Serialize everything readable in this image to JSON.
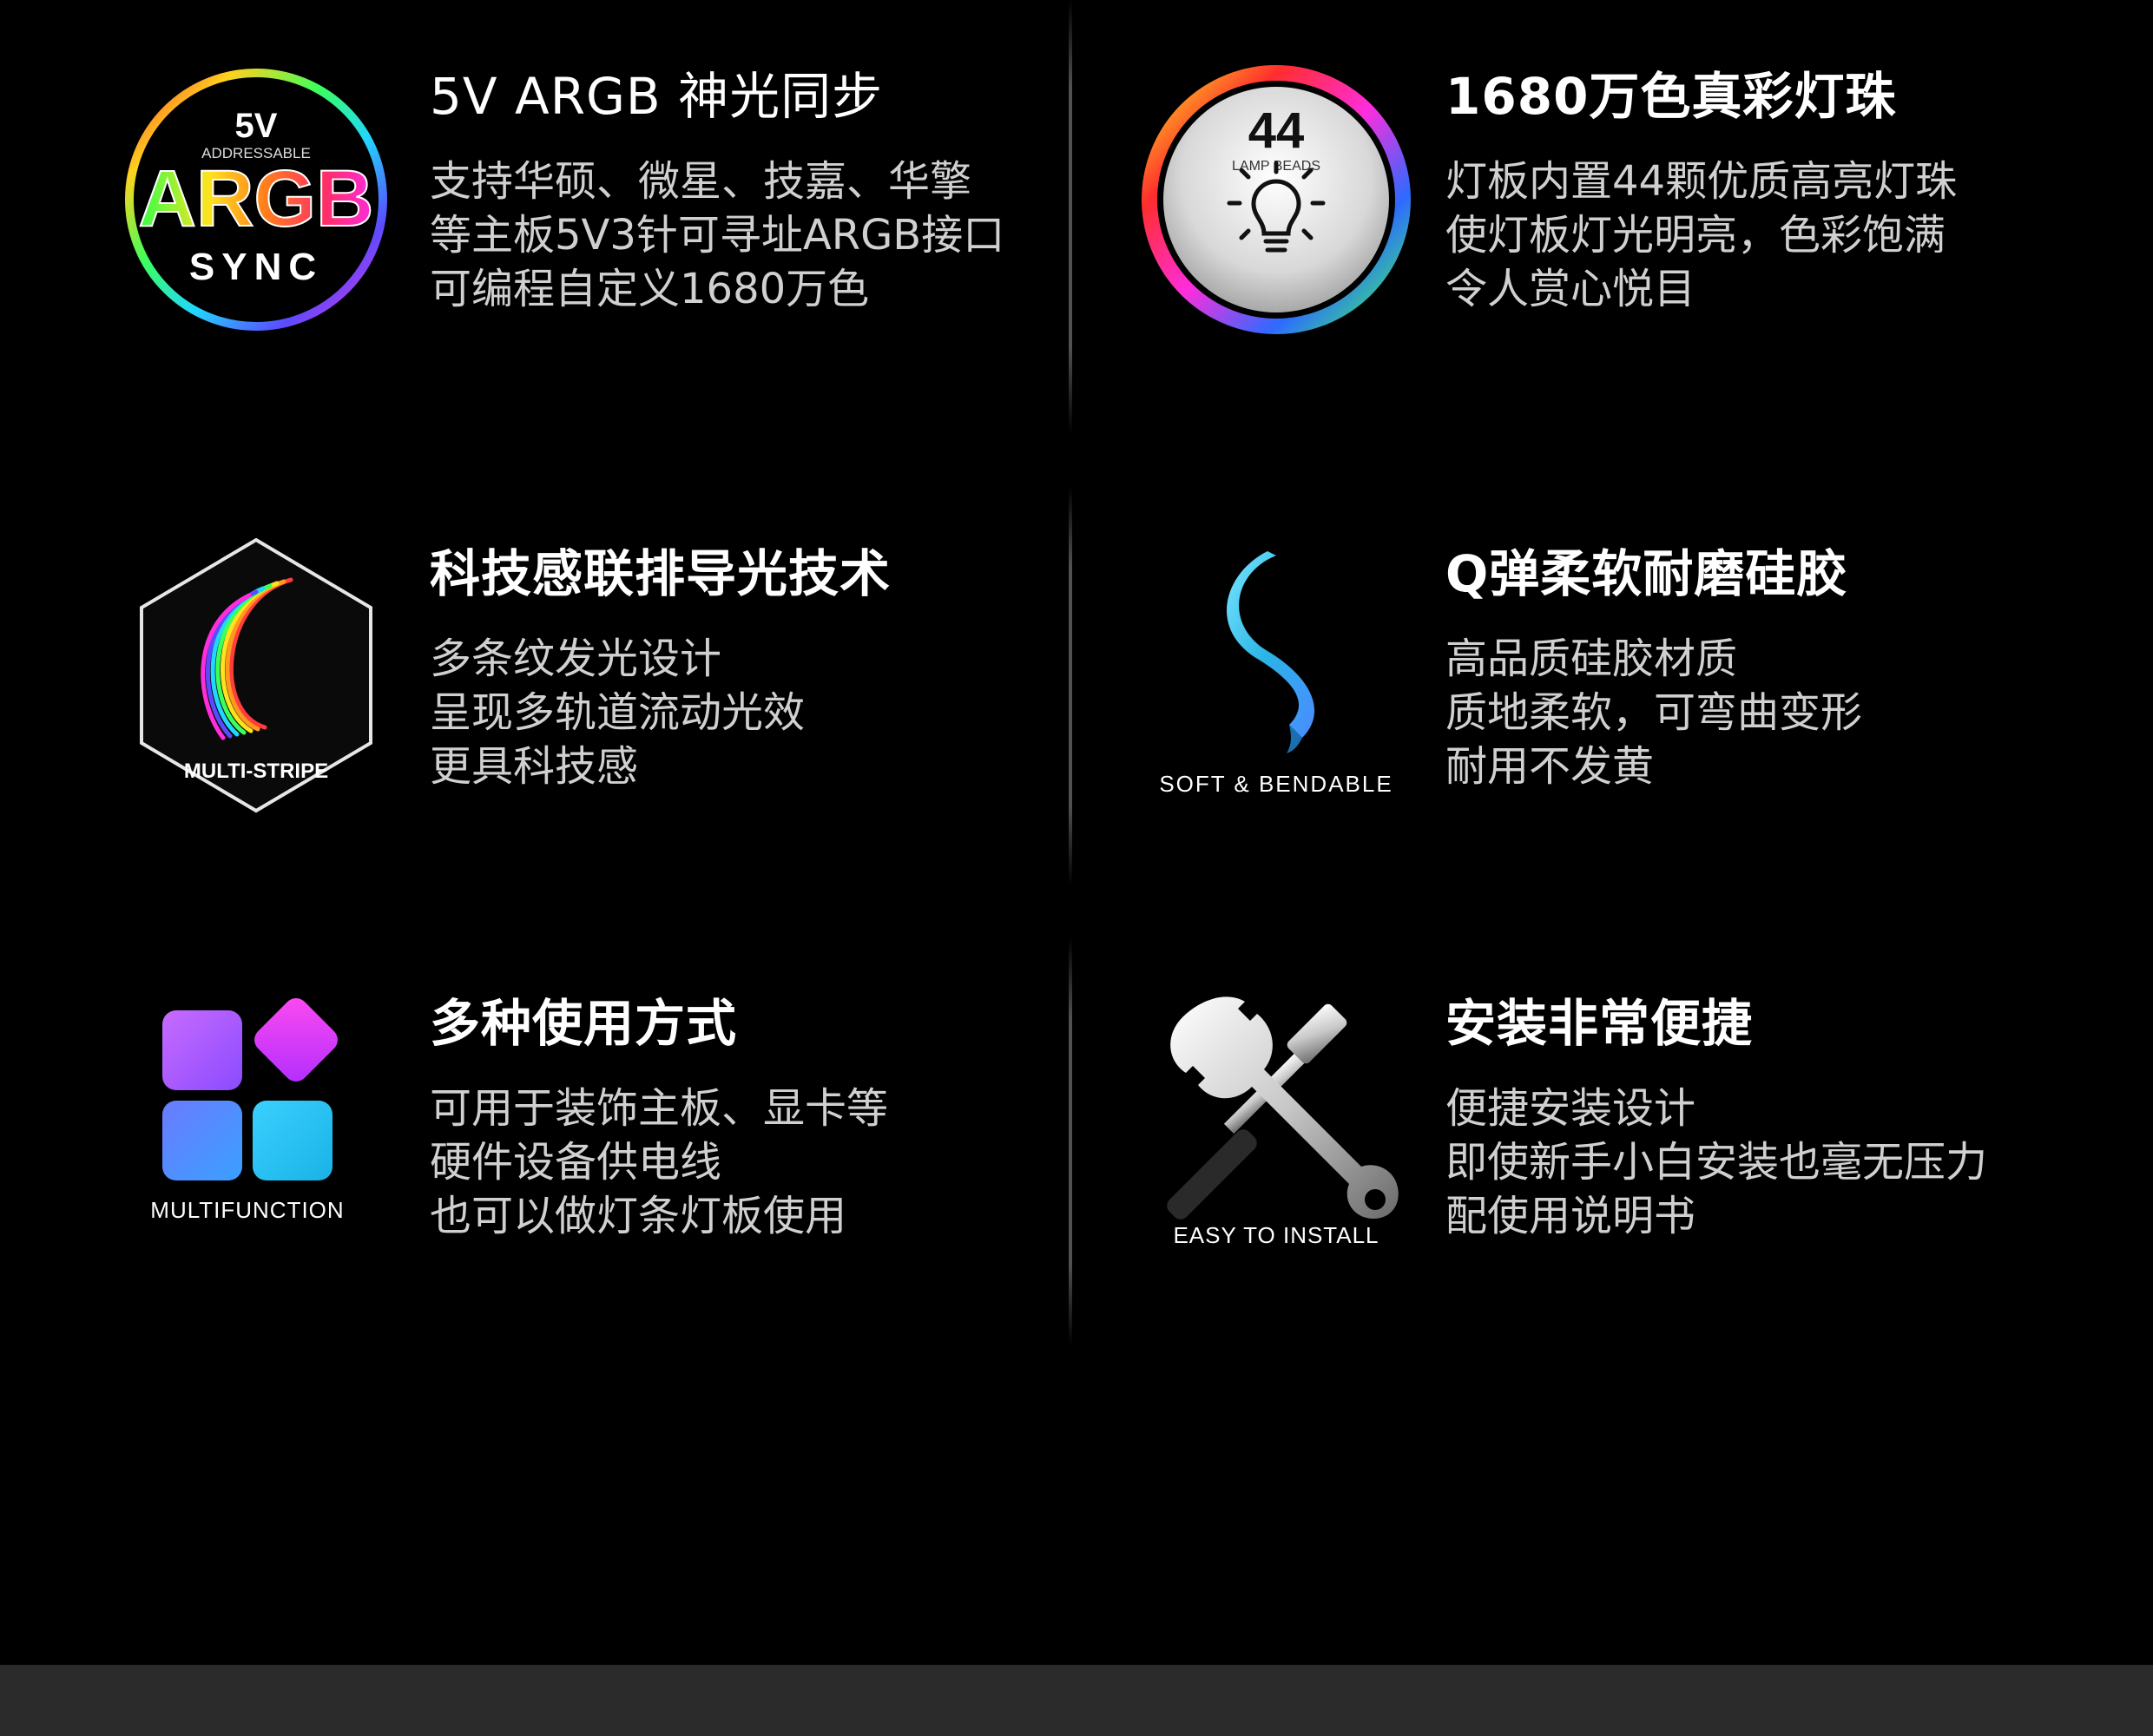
{
  "features": [
    {
      "title": "5V ARGB 神光同步",
      "lines": [
        "支持华硕、微星、技嘉、华擎",
        "等主板5V3针可寻址ARGB接口",
        "可编程自定义1680万色"
      ],
      "badge": {
        "top": "5V",
        "small": "ADDRESSABLE",
        "main": "ARGB",
        "bottom": "SYNC"
      },
      "icon": "argb-sync-badge-icon"
    },
    {
      "title": "1680万色真彩灯珠",
      "lines": [
        "灯板内置44颗优质高亮灯珠",
        "使灯板灯光明亮，色彩饱满",
        "令人赏心悦目"
      ],
      "badge": {
        "number": "44",
        "caption": "LAMP BEADS"
      },
      "icon": "lamp-beads-badge-icon"
    },
    {
      "title": "科技感联排导光技术",
      "lines": [
        "多条纹发光设计",
        "呈现多轨道流动光效",
        "更具科技感"
      ],
      "badge": {
        "caption": "MULTI-STRIPE"
      },
      "icon": "multi-stripe-hexagon-icon"
    },
    {
      "title": "Q弹柔软耐磨硅胶",
      "lines": [
        "高品质硅胶材质",
        "质地柔软，可弯曲变形",
        "耐用不发黄"
      ],
      "badge": {
        "caption": "SOFT & BENDABLE"
      },
      "icon": "soft-bendable-ribbon-icon"
    },
    {
      "title": "多种使用方式",
      "lines": [
        "可用于装饰主板、显卡等",
        "硬件设备供电线",
        "也可以做灯条灯板使用"
      ],
      "badge": {
        "caption": "MULTIFUNCTION"
      },
      "icon": "multifunction-tiles-icon"
    },
    {
      "title": "安装非常便捷",
      "lines": [
        "便捷安装设计",
        "即使新手小白安装也毫无压力",
        "配使用说明书"
      ],
      "badge": {
        "caption": "EASY TO INSTALL"
      },
      "icon": "wrench-screwdriver-icon"
    }
  ],
  "colors": {
    "background": "#000000",
    "title": "#ffffff",
    "body_text": "#d0d0d0",
    "bottom_bar": "#2b2b2b"
  }
}
